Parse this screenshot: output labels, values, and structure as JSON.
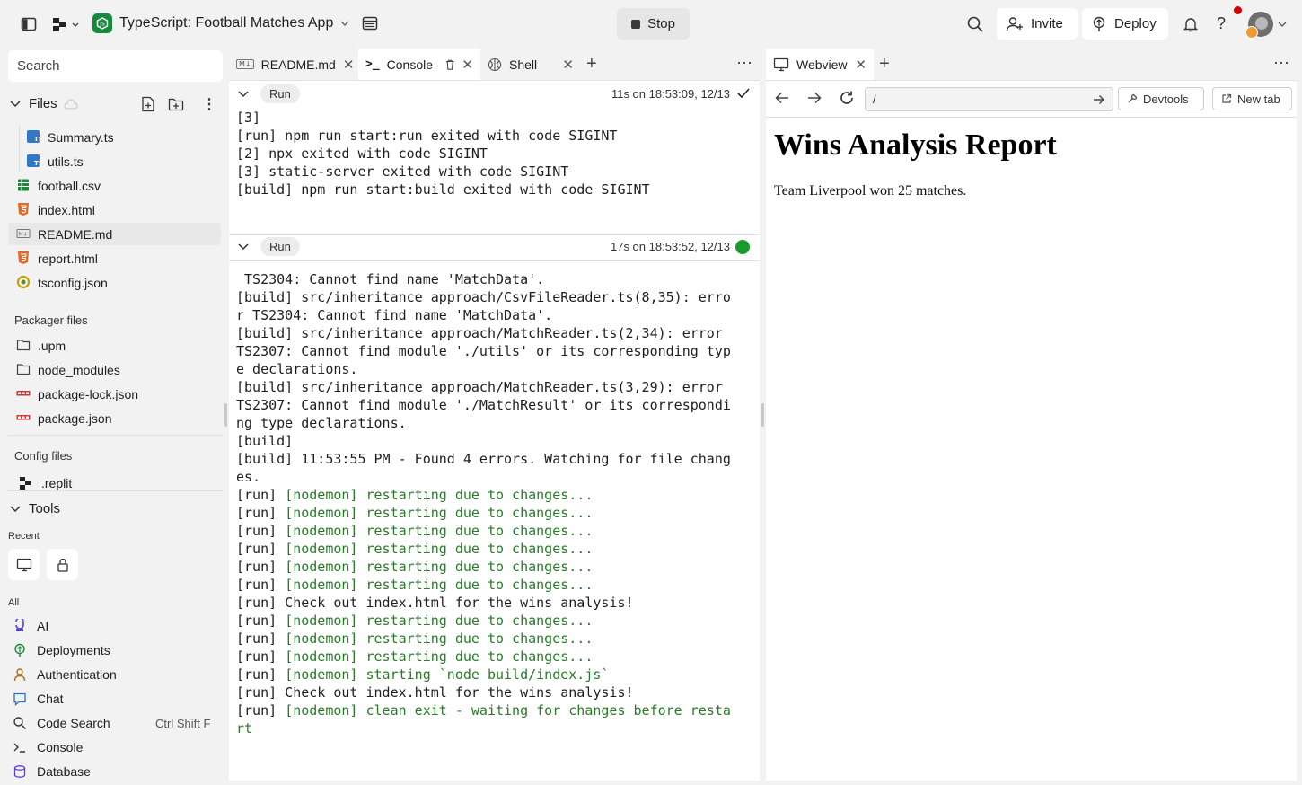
{
  "topbar": {
    "project_name": "TypeScript: Football Matches App",
    "stop_label": "Stop",
    "invite_label": "Invite",
    "deploy_label": "Deploy",
    "help_label": "?"
  },
  "sidebar": {
    "search_placeholder": "Search",
    "files_label": "Files",
    "files": [
      {
        "name": "Summary.ts",
        "type": "ts"
      },
      {
        "name": "utils.ts",
        "type": "ts"
      },
      {
        "name": "football.csv",
        "type": "csv"
      },
      {
        "name": "index.html",
        "type": "html"
      },
      {
        "name": "README.md",
        "type": "md"
      },
      {
        "name": "report.html",
        "type": "html"
      },
      {
        "name": "tsconfig.json",
        "type": "json"
      }
    ],
    "packager_label": "Packager files",
    "packager_files": [
      {
        "name": ".upm",
        "type": "folder"
      },
      {
        "name": "node_modules",
        "type": "folder"
      },
      {
        "name": "package-lock.json",
        "type": "npm"
      },
      {
        "name": "package.json",
        "type": "npm"
      }
    ],
    "config_label": "Config files",
    "config_files": [
      {
        "name": ".replit"
      }
    ],
    "tools_label": "Tools",
    "recent_label": "Recent",
    "all_label": "All",
    "tools": [
      {
        "name": "AI",
        "icon": "ai-icon"
      },
      {
        "name": "Deployments",
        "icon": "deployments-icon"
      },
      {
        "name": "Authentication",
        "icon": "user-icon"
      },
      {
        "name": "Chat",
        "icon": "chat-icon"
      },
      {
        "name": "Code Search",
        "icon": "search-icon",
        "shortcut": "Ctrl Shift F"
      },
      {
        "name": "Console",
        "icon": "console-icon"
      },
      {
        "name": "Database",
        "icon": "database-icon"
      }
    ]
  },
  "editor": {
    "tabs": [
      {
        "label": "README.md"
      },
      {
        "label": "Console"
      },
      {
        "label": "Shell"
      }
    ],
    "runs": [
      {
        "label": "Run",
        "time": "11s on 18:53:09, 12/13",
        "status": "done",
        "lines": [
          {
            "text": "[3]",
            "green": ""
          },
          {
            "text": "[run] npm run start:run exited with code SIGINT",
            "green": ""
          },
          {
            "text": "[2] npx exited with code SIGINT",
            "green": ""
          },
          {
            "text": "[3] static-server exited with code SIGINT",
            "green": ""
          },
          {
            "text": "[build] npm run start:build exited with code SIGINT",
            "green": ""
          }
        ]
      },
      {
        "label": "Run",
        "time": "17s on 18:53:52, 12/13",
        "status": "running",
        "lines": [
          {
            "text": " TS2304: Cannot find name 'MatchData'.",
            "green": ""
          },
          {
            "text": "[build] src/inheritance approach/CsvFileReader.ts(8,35): erro",
            "green": ""
          },
          {
            "text": "r TS2304: Cannot find name 'MatchData'.",
            "green": ""
          },
          {
            "text": "[build] src/inheritance approach/MatchReader.ts(2,34): error",
            "green": ""
          },
          {
            "text": "TS2307: Cannot find module './utils' or its corresponding typ",
            "green": ""
          },
          {
            "text": "e declarations.",
            "green": ""
          },
          {
            "text": "[build] src/inheritance approach/MatchReader.ts(3,29): error",
            "green": ""
          },
          {
            "text": "TS2307: Cannot find module './MatchResult' or its correspondi",
            "green": ""
          },
          {
            "text": "ng type declarations.",
            "green": ""
          },
          {
            "text": "[build]",
            "green": ""
          },
          {
            "text": "[build] 11:53:55 PM - Found 4 errors. Watching for file chang",
            "green": ""
          },
          {
            "text": "es.",
            "green": ""
          },
          {
            "text": "[run] ",
            "green": "[nodemon] restarting due to changes..."
          },
          {
            "text": "[run] ",
            "green": "[nodemon] restarting due to changes..."
          },
          {
            "text": "[run] ",
            "green": "[nodemon] restarting due to changes..."
          },
          {
            "text": "[run] ",
            "green": "[nodemon] restarting due to changes..."
          },
          {
            "text": "[run] ",
            "green": "[nodemon] restarting due to changes..."
          },
          {
            "text": "[run] ",
            "green": "[nodemon] restarting due to changes..."
          },
          {
            "text": "[run] Check out index.html for the wins analysis!",
            "green": ""
          },
          {
            "text": "[run] ",
            "green": "[nodemon] restarting due to changes..."
          },
          {
            "text": "[run] ",
            "green": "[nodemon] restarting due to changes..."
          },
          {
            "text": "[run] ",
            "green": "[nodemon] restarting due to changes..."
          },
          {
            "text": "[run] ",
            "green": "[nodemon] starting `node build/index.js`"
          },
          {
            "text": "[run] Check out index.html for the wins analysis!",
            "green": ""
          },
          {
            "text": "[run] ",
            "green": "[nodemon] clean exit - waiting for changes before resta"
          },
          {
            "text": "",
            "green": "rt"
          }
        ]
      }
    ]
  },
  "webview": {
    "tab_label": "Webview",
    "url": "/",
    "devtools_label": "Devtools",
    "newtab_label": "New tab",
    "heading": "Wins Analysis Report",
    "body": "Team Liverpool won 25 matches."
  },
  "colors": {
    "accent_green": "#2a7a2a",
    "run_dot": "#1a9a2a",
    "ts_blue": "#3178c6",
    "html_orange": "#e06b26",
    "npm_red": "#cb3837"
  }
}
